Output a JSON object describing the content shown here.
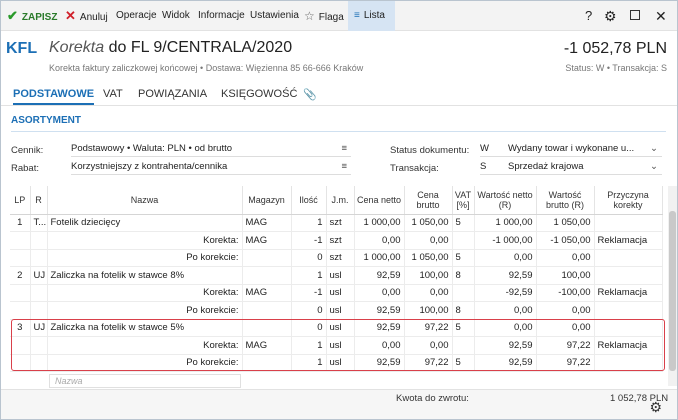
{
  "toolbar": {
    "save": "ZAPISZ",
    "cancel": "Anuluj",
    "operations": "Operacje",
    "view": "Widok",
    "info": "Informacje",
    "settings": "Ustawienia",
    "flag": "Flaga",
    "list": "Lista",
    "help": "?"
  },
  "header": {
    "logo": "KFL",
    "title_prefix": "Korekta",
    "title_rest": "do FL 9/CENTRALA/2020",
    "subtitle": "Korekta faktury zaliczkowej końcowej  •  Dostawa: Więzienna  85  66-666 Kraków",
    "amount": "-1 052,78 PLN",
    "status": "Status:  W  •  Transakcja:  S"
  },
  "tabs": [
    "PODSTAWOWE",
    "VAT",
    "POWIĄZANIA",
    "KSIĘGOWOŚĆ"
  ],
  "section": "ASORTYMENT",
  "form": {
    "cennik_label": "Cennik:",
    "cennik_value": "Podstawowy • Waluta: PLN • od brutto",
    "rabat_label": "Rabat:",
    "rabat_value": "Korzystniejszy z kontrahenta/cennika",
    "status_label": "Status dokumentu:",
    "status_code": "W",
    "status_value": "Wydany towar i wykonane u...",
    "trans_label": "Transakcja:",
    "trans_code": "S",
    "trans_value": "Sprzedaż krajowa"
  },
  "columns": [
    "LP",
    "R",
    "Nazwa",
    "Magazyn",
    "Ilość",
    "J.m.",
    "Cena netto",
    "Cena brutto",
    "VAT [%]",
    "Wartość netto (R)",
    "Wartość brutto (R)",
    "Przyczyna korekty"
  ],
  "rows": [
    [
      "1",
      "T...",
      "Fotelik dziecięcy",
      "MAG",
      "1",
      "szt",
      "1 000,00",
      "1 050,00",
      "5",
      "1 000,00",
      "1 050,00",
      ""
    ],
    [
      "",
      "",
      "Korekta:",
      "MAG",
      "-1",
      "szt",
      "0,00",
      "0,00",
      "",
      "-1 000,00",
      "-1 050,00",
      "Reklamacja"
    ],
    [
      "",
      "",
      "Po korekcie:",
      "",
      "0",
      "szt",
      "1 000,00",
      "1 050,00",
      "5",
      "0,00",
      "0,00",
      ""
    ],
    [
      "2",
      "UJ",
      "Zaliczka na fotelik w stawce 8%",
      "",
      "1",
      "usl",
      "92,59",
      "100,00",
      "8",
      "92,59",
      "100,00",
      ""
    ],
    [
      "",
      "",
      "Korekta:",
      "MAG",
      "-1",
      "usl",
      "0,00",
      "0,00",
      "",
      "-92,59",
      "-100,00",
      "Reklamacja"
    ],
    [
      "",
      "",
      "Po korekcie:",
      "",
      "0",
      "usl",
      "92,59",
      "100,00",
      "8",
      "0,00",
      "0,00",
      ""
    ],
    [
      "3",
      "UJ",
      "Zaliczka na fotelik w stawce 5%",
      "",
      "0",
      "usl",
      "92,59",
      "97,22",
      "5",
      "0,00",
      "0,00",
      ""
    ],
    [
      "",
      "",
      "Korekta:",
      "MAG",
      "1",
      "usl",
      "0,00",
      "0,00",
      "",
      "92,59",
      "97,22",
      "Reklamacja"
    ],
    [
      "",
      "",
      "Po korekcie:",
      "",
      "1",
      "usl",
      "92,59",
      "97,22",
      "5",
      "92,59",
      "97,22",
      ""
    ]
  ],
  "new_row_placeholder": "Nazwa",
  "footer": {
    "label": "Kwota do zwrotu:",
    "value": "1 052,78 PLN"
  }
}
